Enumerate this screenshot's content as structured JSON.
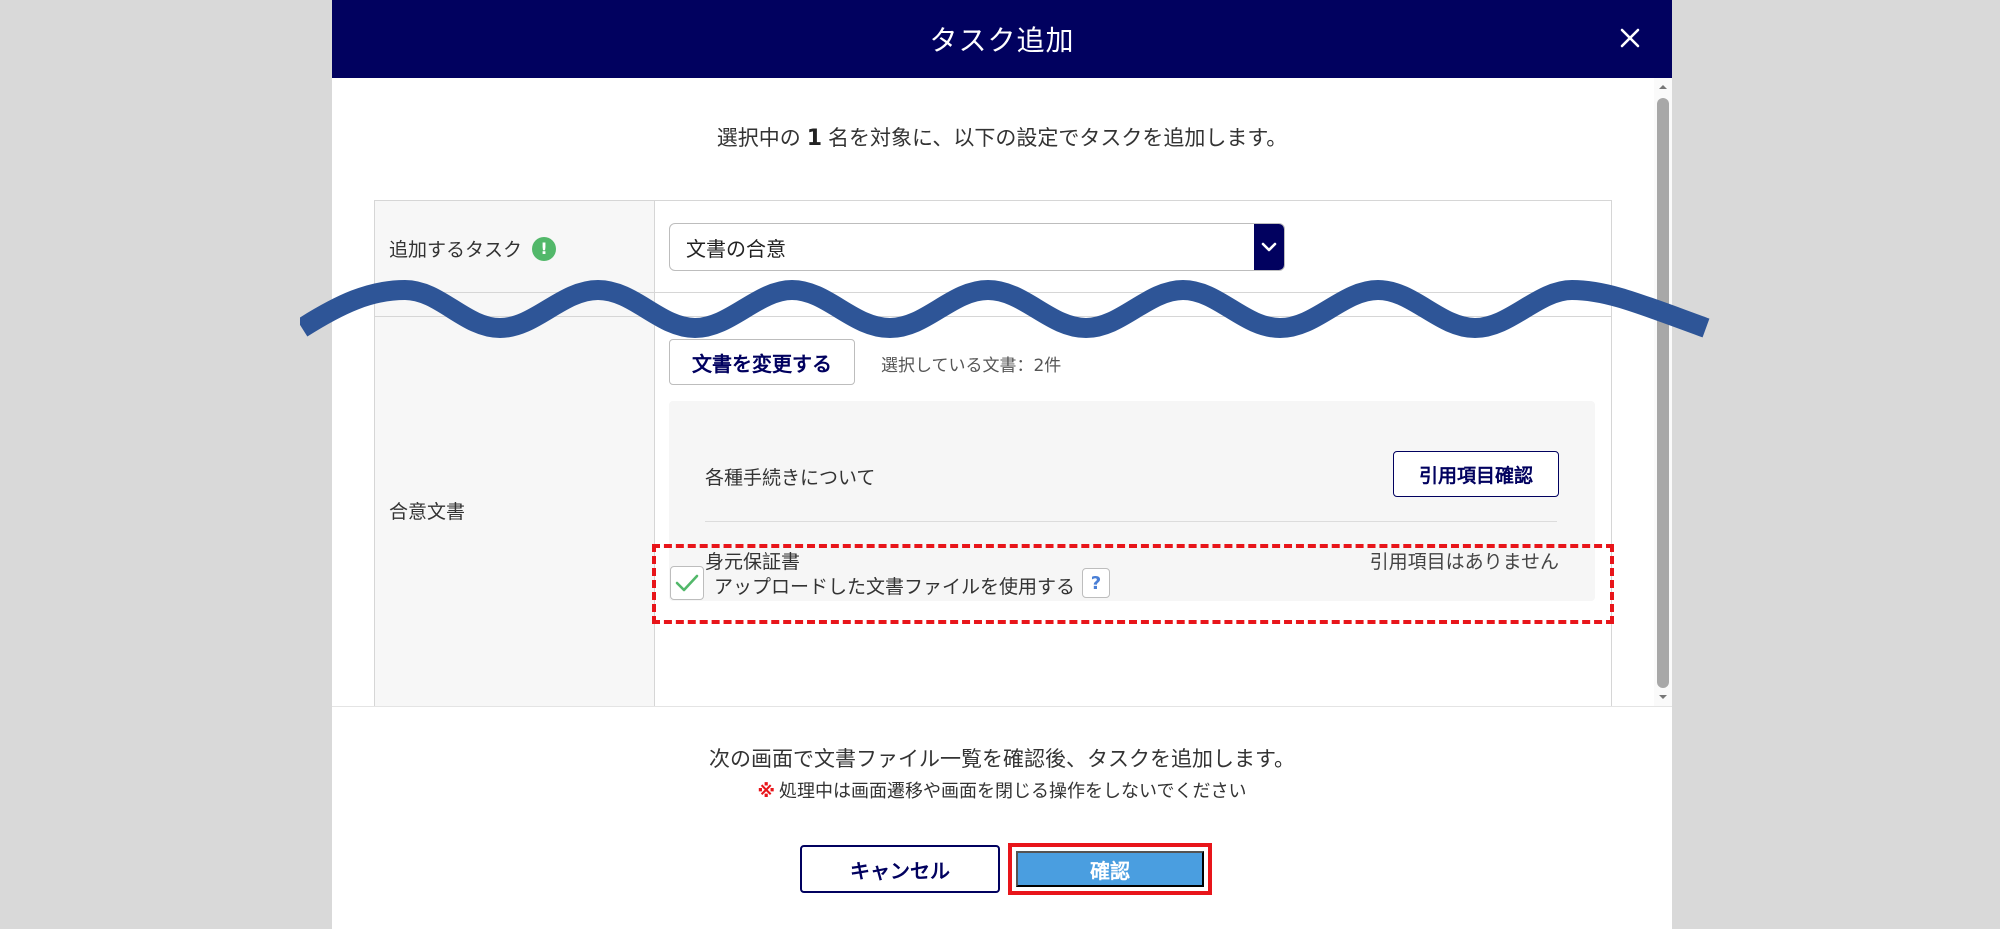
{
  "modal": {
    "title": "タスク追加",
    "intro_prefix": "選択中の",
    "intro_count": "1",
    "intro_suffix": "名を対象に、以下の設定でタスクを追加します。"
  },
  "task_row": {
    "label": "追加するタスク",
    "badge": "!",
    "select_value": "文書の合意"
  },
  "doc_row": {
    "label": "合意文書",
    "change_button": "文書を変更する",
    "selected_count": "選択している文書：2件",
    "documents": [
      {
        "name": "各種手続きについて",
        "action_label": "引用項目確認"
      },
      {
        "name": "身元保証書",
        "status": "引用項目はありません"
      }
    ]
  },
  "upload": {
    "label": "アップロードした文書ファイルを使用する",
    "checked": true,
    "help": "?"
  },
  "footer": {
    "message": "次の画面で文書ファイル一覧を確認後、タスクを追加します。",
    "warning_mark": "※",
    "warning": "処理中は画面遷移や画面を閉じる操作をしないでください",
    "cancel_label": "キャンセル",
    "confirm_label": "確認"
  },
  "colors": {
    "header": "#01015f",
    "accent": "#4a9ee0",
    "highlight": "#e8151a",
    "success": "#52b86a",
    "wave": "#2e5597"
  }
}
